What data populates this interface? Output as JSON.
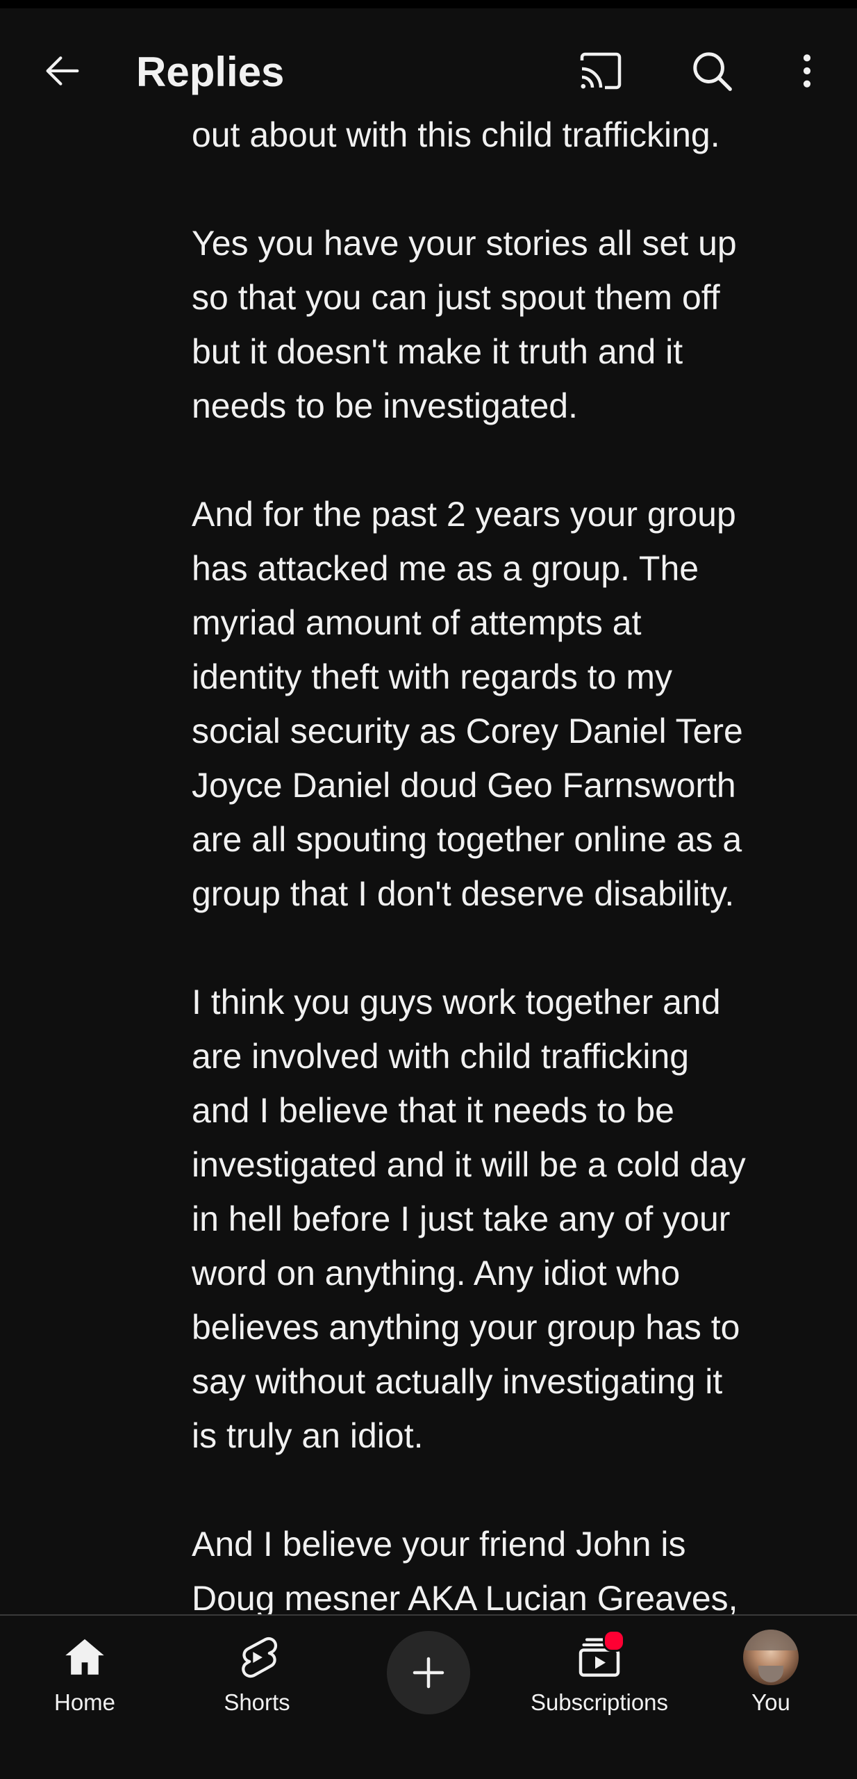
{
  "header": {
    "title": "Replies",
    "back_icon": "arrow-left-icon",
    "cast_icon": "cast-icon",
    "search_icon": "search-icon",
    "more_icon": "more-vert-icon"
  },
  "comment": {
    "paragraphs": [
      "out about with this child trafficking.",
      "Yes you have your stories all set up\nso that you can just spout them off\nbut it doesn't make it truth and it\nneeds to be investigated.",
      "And for the past 2 years your group\nhas attacked me as a group. The\nmyriad amount of attempts at\nidentity theft with regards to my\nsocial security as Corey Daniel Tere\nJoyce Daniel doud Geo Farnsworth\nare all spouting together online as a\ngroup that I don't deserve disability.",
      "I think you guys work together and\nare involved with child trafficking\nand I believe that it needs to be\ninvestigated and it will be a cold day\nin hell before I just take any of your\nword on anything. Any idiot who\nbelieves anything your group has to\nsay without actually investigating it\nis truly an idiot.",
      "And I believe your friend John is\nDoug mesner AKA Lucian Greaves,"
    ]
  },
  "nav": {
    "home": "Home",
    "shorts": "Shorts",
    "create_icon": "plus-icon",
    "subscriptions": "Subscriptions",
    "you": "You"
  },
  "colors": {
    "background": "#0f0f0f",
    "text": "#f1f1f1",
    "notification": "#ff0033"
  }
}
